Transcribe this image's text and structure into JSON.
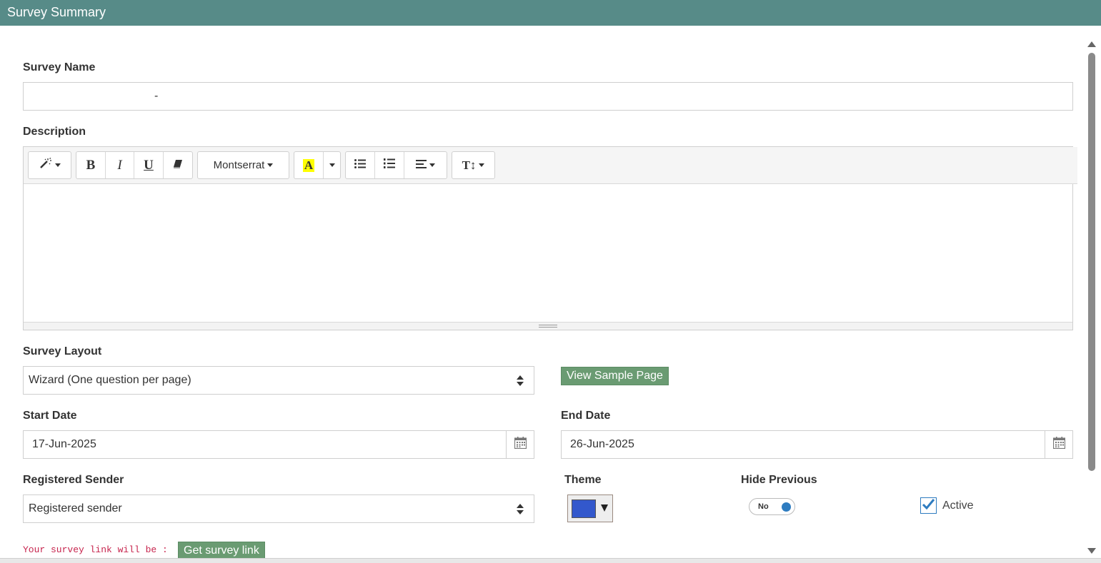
{
  "header": {
    "title": "Survey Summary"
  },
  "survey_name": {
    "label": "Survey Name",
    "value": "-"
  },
  "description": {
    "label": "Description",
    "toolbar": {
      "font_name": "Montserrat",
      "bold": "B",
      "italic": "I",
      "underline": "U",
      "highlight_letter": "A",
      "highlight_color": "#ffff00",
      "font_size_label": "T↕"
    }
  },
  "survey_layout": {
    "label": "Survey Layout",
    "selected": "Wizard (One question per page)"
  },
  "view_sample_button": "View Sample Page",
  "start_date": {
    "label": "Start Date",
    "value": "17-Jun-2025"
  },
  "end_date": {
    "label": "End Date",
    "value": "26-Jun-2025"
  },
  "registered_sender": {
    "label": "Registered Sender",
    "selected": "Registered sender"
  },
  "theme": {
    "label": "Theme",
    "color": "#3358cc"
  },
  "hide_previous": {
    "label": "Hide Previous",
    "toggle_text": "No"
  },
  "active": {
    "label": "Active",
    "checked": true
  },
  "survey_link": {
    "note": "Your survey link will be :",
    "button": "Get survey link"
  },
  "colors": {
    "header_bg": "#578b88",
    "accent_green": "#6a9b72",
    "link_note": "#c7254e",
    "toggle_knob": "#2e7cc0"
  }
}
